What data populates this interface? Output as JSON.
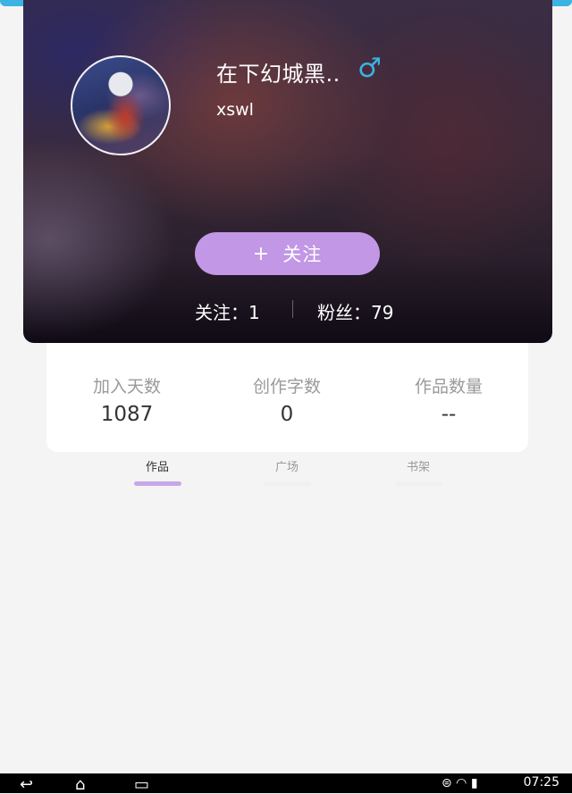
{
  "profile": {
    "username": "在下幻城黑..",
    "gender_icon": "male-icon",
    "gender_symbol": "♂",
    "gender_color": "#3cb3e3",
    "user_id": "xswl",
    "follow_button": {
      "plus": "+",
      "label": "关注"
    },
    "following_text": "关注：1",
    "fans_text": "粉丝：79"
  },
  "metrics": [
    {
      "label": "加入天数",
      "value": "1087"
    },
    {
      "label": "创作字数",
      "value": "0"
    },
    {
      "label": "作品数量",
      "value": "--"
    }
  ],
  "tabs": [
    {
      "label": "作品",
      "active": true
    },
    {
      "label": "广场",
      "active": false
    },
    {
      "label": "书架",
      "active": false
    }
  ],
  "colors": {
    "accent": "#c197e6",
    "topbar": "#3cb3e3",
    "active_tab_indicator": "#c8a6e8",
    "inactive_tab_indicator": "#f0f0f0"
  },
  "system_bar": {
    "icons": [
      "back-icon",
      "home-icon",
      "recent-apps-icon",
      "chat-icon",
      "wifi-icon",
      "battery-icon"
    ],
    "back_symbol": "↩",
    "home_symbol": "⌂",
    "recents_symbol": "▭",
    "status_symbols": "⊜ ◠ ▮",
    "time": "07:25"
  }
}
